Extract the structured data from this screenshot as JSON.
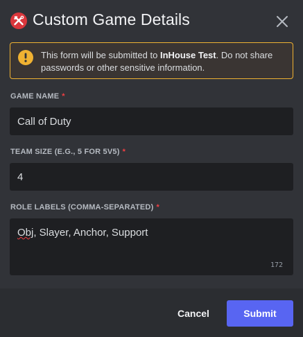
{
  "modal": {
    "title": "Custom Game Details",
    "app_icon": "crossed-tools-icon",
    "close_icon": "close-icon"
  },
  "notice": {
    "icon": "warning-icon",
    "text_before": "This form will be submitted to ",
    "server_name": "InHouse Test",
    "text_after": ". Do not share passwords or other sensitive information."
  },
  "fields": {
    "game_name": {
      "label": "GAME NAME",
      "required": "*",
      "value": "Call of Duty"
    },
    "team_size": {
      "label": "TEAM SIZE (E.G., 5 FOR 5V5)",
      "required": "*",
      "value": "4"
    },
    "role_labels": {
      "label": "ROLE LABELS (COMMA-SEPARATED)",
      "required": "*",
      "value_misspelled": "Obj",
      "value_rest": ", Slayer, Anchor, Support",
      "char_counter": "172"
    }
  },
  "footer": {
    "cancel_label": "Cancel",
    "submit_label": "Submit"
  },
  "colors": {
    "background": "#313338",
    "footer": "#2b2d31",
    "input": "#1e1f22",
    "accent": "#5865f2",
    "warning": "#f0b232",
    "required": "#f23f43",
    "app_icon": "#da373c"
  }
}
